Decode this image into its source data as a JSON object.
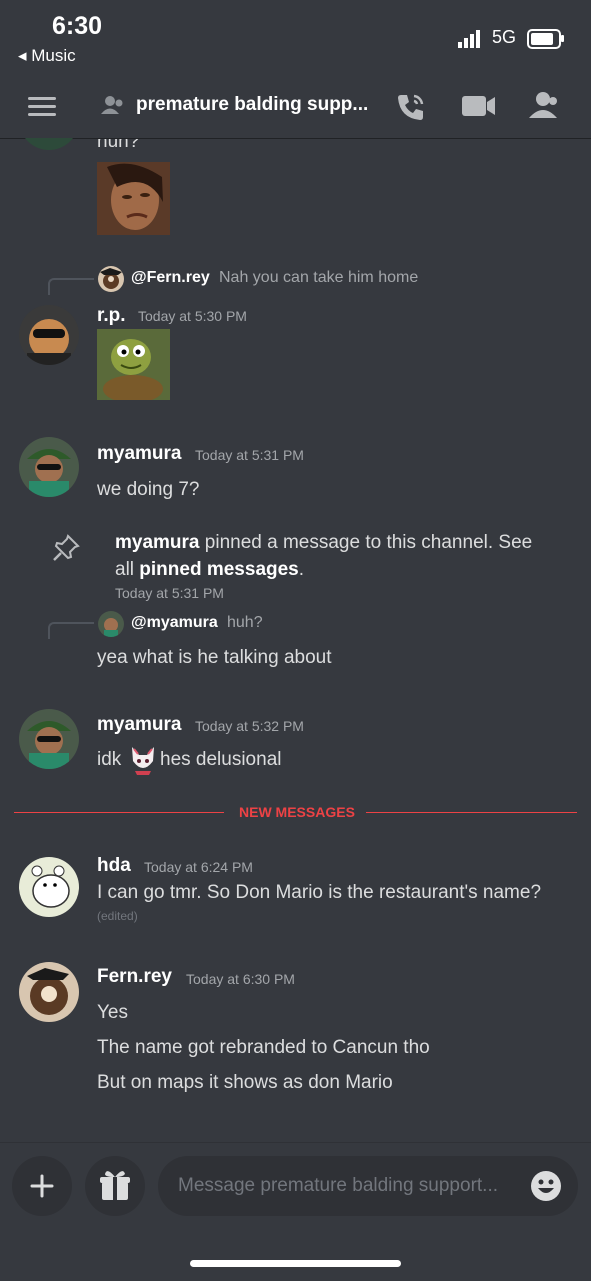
{
  "status_bar": {
    "time": "6:30",
    "back_app": "◂ Music",
    "network": "5G"
  },
  "header": {
    "channel_title": "premature balding supp..."
  },
  "messages": {
    "top_partial_text": "huh?",
    "reply1": {
      "name": "@Fern.rey",
      "text": "Nah you can take him home"
    },
    "rp": {
      "username": "r.p.",
      "timestamp": "Today at 5:30 PM"
    },
    "my1": {
      "username": "myamura",
      "timestamp": "Today at 5:31 PM",
      "text": "we doing 7?"
    },
    "pin": {
      "actor": "myamura",
      "text1": " pinned a message to this channel. See",
      "text2": "all ",
      "link": "pinned messages",
      "text3": ".",
      "timestamp": "Today at 5:31 PM"
    },
    "reply2": {
      "name": "@myamura",
      "text": "huh?"
    },
    "reply2_body": "yea what is he talking about",
    "my2": {
      "username": "myamura",
      "timestamp": "Today at 5:32 PM",
      "text_before": "idk",
      "text_after": "hes delusional"
    },
    "divider_label": "NEW MESSAGES",
    "hda": {
      "username": "hda",
      "timestamp": "Today at 6:24 PM",
      "text": "I can go tmr. So Don Mario is the restaurant's name?",
      "edited": "(edited)"
    },
    "fern": {
      "username": "Fern.rey",
      "timestamp": "Today at 6:30 PM",
      "lines": [
        "Yes",
        "The name got rebranded to Cancun tho",
        "But on maps it shows as don Mario"
      ]
    }
  },
  "composer": {
    "placeholder": "Message premature balding support..."
  },
  "colors": {
    "background": "#36393f",
    "divider_red": "#ed4245",
    "muted": "#a3a6aa"
  }
}
